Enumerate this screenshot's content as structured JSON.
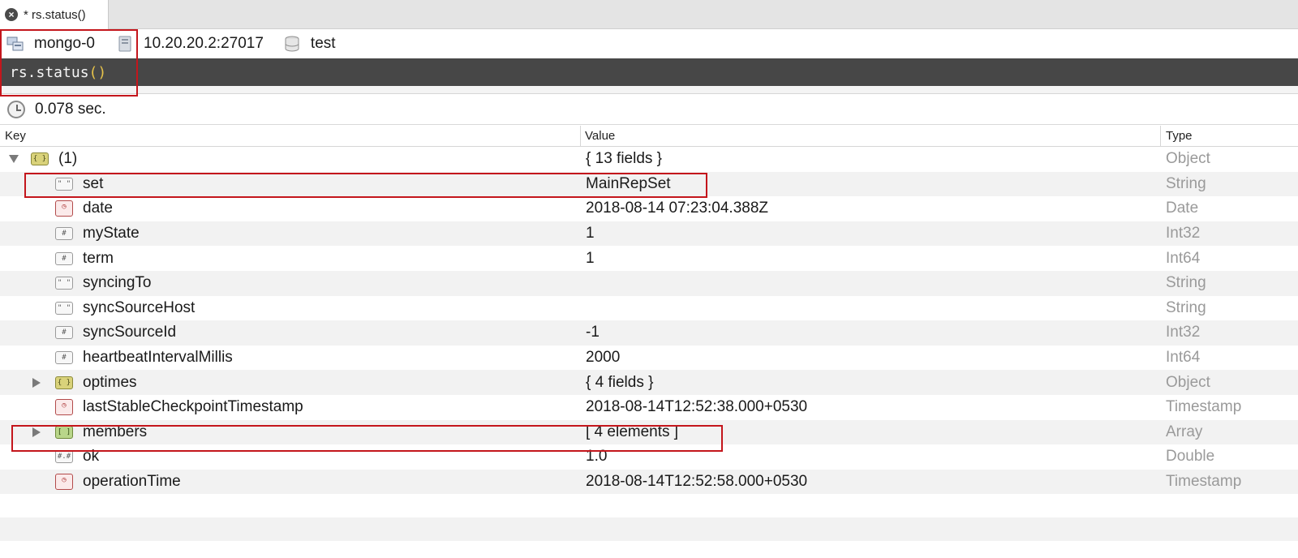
{
  "tab": {
    "title": "* rs.status()",
    "close_icon": "close-icon"
  },
  "connection": {
    "server": "mongo-0",
    "host": "10.20.20.2:27017",
    "database": "test"
  },
  "editor": {
    "code": "rs.status",
    "parens": "()"
  },
  "exec_time": "0.078 sec.",
  "columns": {
    "key": "Key",
    "value": "Value",
    "type": "Type"
  },
  "rows": [
    {
      "key": "(1)",
      "value": "{ 13 fields }",
      "type": "Object",
      "icon": "object-icon",
      "expander": "expanded"
    },
    {
      "key": "set",
      "value": "MainRepSet",
      "type": "String",
      "icon": "string-icon"
    },
    {
      "key": "date",
      "value": "2018-08-14 07:23:04.388Z",
      "type": "Date",
      "icon": "date-icon"
    },
    {
      "key": "myState",
      "value": "1",
      "type": "Int32",
      "icon": "number-icon"
    },
    {
      "key": "term",
      "value": "1",
      "type": "Int64",
      "icon": "number-icon"
    },
    {
      "key": "syncingTo",
      "value": "",
      "type": "String",
      "icon": "string-icon"
    },
    {
      "key": "syncSourceHost",
      "value": "",
      "type": "String",
      "icon": "string-icon"
    },
    {
      "key": "syncSourceId",
      "value": "-1",
      "type": "Int32",
      "icon": "number-icon"
    },
    {
      "key": "heartbeatIntervalMillis",
      "value": "2000",
      "type": "Int64",
      "icon": "number-icon"
    },
    {
      "key": "optimes",
      "value": "{ 4 fields }",
      "type": "Object",
      "icon": "object-icon",
      "expander": "collapsed"
    },
    {
      "key": "lastStableCheckpointTimestamp",
      "value": "2018-08-14T12:52:38.000+0530",
      "type": "Timestamp",
      "icon": "date-icon"
    },
    {
      "key": "members",
      "value": "[ 4 elements ]",
      "type": "Array",
      "icon": "array-icon",
      "expander": "collapsed"
    },
    {
      "key": "ok",
      "value": "1.0",
      "type": "Double",
      "icon": "double-icon"
    },
    {
      "key": "operationTime",
      "value": "2018-08-14T12:52:58.000+0530",
      "type": "Timestamp",
      "icon": "date-icon"
    }
  ],
  "colors": {
    "highlight": "#c4161c",
    "editor_bg": "#474747",
    "type_text": "#9a9a9a"
  }
}
